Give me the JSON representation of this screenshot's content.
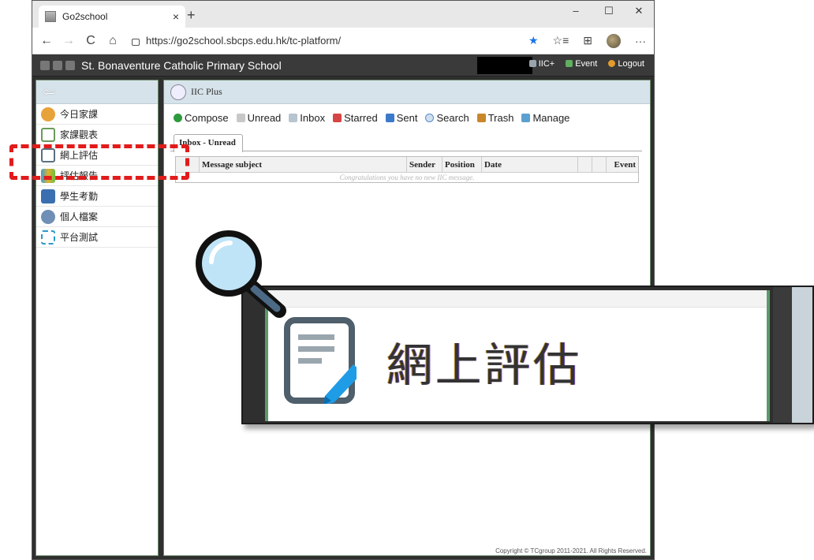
{
  "browser": {
    "tab_title": "Go2school",
    "tab_close": "×",
    "new_tab": "+",
    "url": "https://go2school.sbcps.edu.hk/tc-platform/",
    "win_minimize": "–",
    "win_maximize": "☐",
    "win_close": "✕",
    "nav_back": "←",
    "nav_forward": "→",
    "nav_refresh": "C",
    "nav_home": "⌂",
    "star": "★",
    "favorites": "☆≡",
    "collections": "⊞",
    "more": "···"
  },
  "header": {
    "school_name": "St. Bonaventure Catholic Primary School",
    "nav": [
      "IIC+",
      "Event",
      "Logout"
    ],
    "nav_colors": [
      "#9aa4ad",
      "#5fb05f",
      "#e39b2c"
    ]
  },
  "sidebar": {
    "back_icon": "⇦",
    "items": [
      {
        "label": "今日家課",
        "icon": "homework-icon",
        "color": "#e8a23a"
      },
      {
        "label": "家課觀表",
        "icon": "schedule-icon",
        "color": "#6a9a5a"
      },
      {
        "label": "網上評估",
        "icon": "assessment-icon",
        "color": "#5a7080"
      },
      {
        "label": "評估報告",
        "icon": "report-icon",
        "color": "#c9a13a"
      },
      {
        "label": "學生考勤",
        "icon": "attendance-icon",
        "color": "#3a6fb0"
      },
      {
        "label": "個人檔案",
        "icon": "profile-icon",
        "color": "#6f8fb6"
      },
      {
        "label": "平台測試",
        "icon": "test-icon",
        "color": "#2a9ac9"
      }
    ]
  },
  "main": {
    "title": "IIC Plus",
    "toolbar": [
      {
        "label": "Compose",
        "icon": "compose-icon",
        "color": "#2e9a3e"
      },
      {
        "label": "Unread",
        "icon": "unread-icon",
        "color": "#8a8a8a"
      },
      {
        "label": "Inbox",
        "icon": "inbox-icon",
        "color": "#7a8a9a"
      },
      {
        "label": "Starred",
        "icon": "starred-icon",
        "color": "#d64545"
      },
      {
        "label": "Sent",
        "icon": "sent-icon",
        "color": "#3a7ac9"
      },
      {
        "label": "Search",
        "icon": "search-icon",
        "color": "#5a8ac9"
      },
      {
        "label": "Trash",
        "icon": "trash-icon",
        "color": "#c9862a"
      },
      {
        "label": "Manage",
        "icon": "manage-icon",
        "color": "#5aa0d0"
      }
    ],
    "active_tab": "Inbox - Unread",
    "columns": [
      "Message subject",
      "Sender",
      "Position",
      "Date",
      "",
      "",
      "Event"
    ],
    "empty_message": "Congratulations you have no new IIC message."
  },
  "footer": {
    "copyright": "Copyright © TCgroup 2011-2021. All Rights Reserved."
  },
  "callout": {
    "label": "網上評估"
  }
}
